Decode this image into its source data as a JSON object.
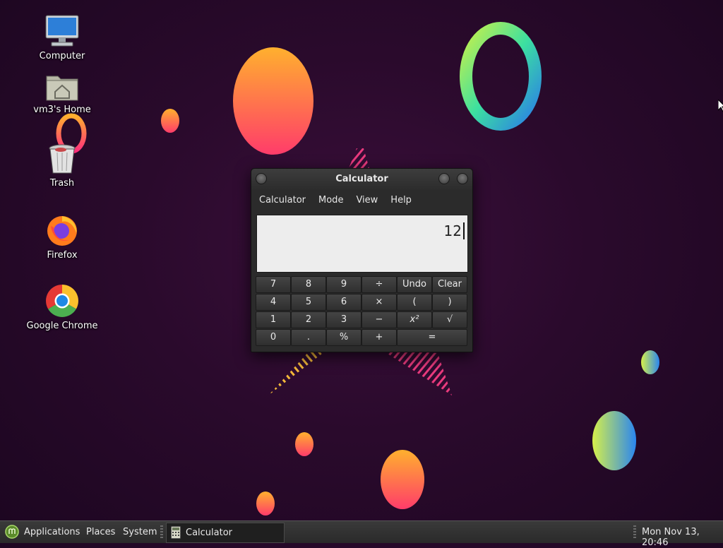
{
  "desktop": {
    "icons": [
      {
        "label": "Computer"
      },
      {
        "label": "vm3's Home"
      },
      {
        "label": "Trash"
      },
      {
        "label": "Firefox"
      },
      {
        "label": "Google Chrome"
      }
    ]
  },
  "calculator": {
    "title": "Calculator",
    "menu": [
      "Calculator",
      "Mode",
      "View",
      "Help"
    ],
    "display_value": "12",
    "keys": [
      [
        "7",
        "8",
        "9",
        "÷",
        "Undo",
        "Clear"
      ],
      [
        "4",
        "5",
        "6",
        "×",
        "(",
        ")"
      ],
      [
        "1",
        "2",
        "3",
        "−",
        "x²",
        "√"
      ],
      [
        "0",
        ".",
        "%",
        "+",
        "="
      ]
    ]
  },
  "panel": {
    "applications": "Applications",
    "places": "Places",
    "system": "System",
    "task_label": "Calculator",
    "clock": "Mon Nov 13, 20:46"
  },
  "colors": {
    "wallpaper_base": "#2a0a2c",
    "panel_bg": "#2e2e2e",
    "window_bg": "#2b2b2b",
    "display_bg": "#ededed"
  }
}
